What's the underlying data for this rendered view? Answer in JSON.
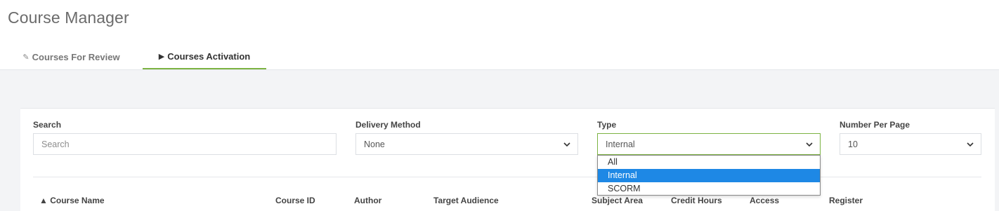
{
  "page": {
    "title": "Course Manager"
  },
  "tabs": [
    {
      "label": "Courses For Review",
      "icon": "pencil-icon",
      "active": false
    },
    {
      "label": "Courses Activation",
      "icon": "play-icon",
      "active": true
    }
  ],
  "filters": {
    "search": {
      "label": "Search",
      "placeholder": "Search",
      "value": ""
    },
    "delivery": {
      "label": "Delivery Method",
      "value": "None"
    },
    "type": {
      "label": "Type",
      "value": "Internal",
      "options": [
        "All",
        "Internal",
        "SCORM"
      ],
      "selected": "Internal"
    },
    "per_page": {
      "label": "Number Per Page",
      "value": "10"
    }
  },
  "table": {
    "columns": [
      "▲ Course Name",
      "Course ID",
      "Author",
      "Target Audience",
      "Subject Area",
      "Credit Hours",
      "Access",
      "Register"
    ]
  },
  "colors": {
    "accent_green": "#7cb342",
    "selection_blue": "#1e88e5",
    "background": "#f3f4f6"
  }
}
